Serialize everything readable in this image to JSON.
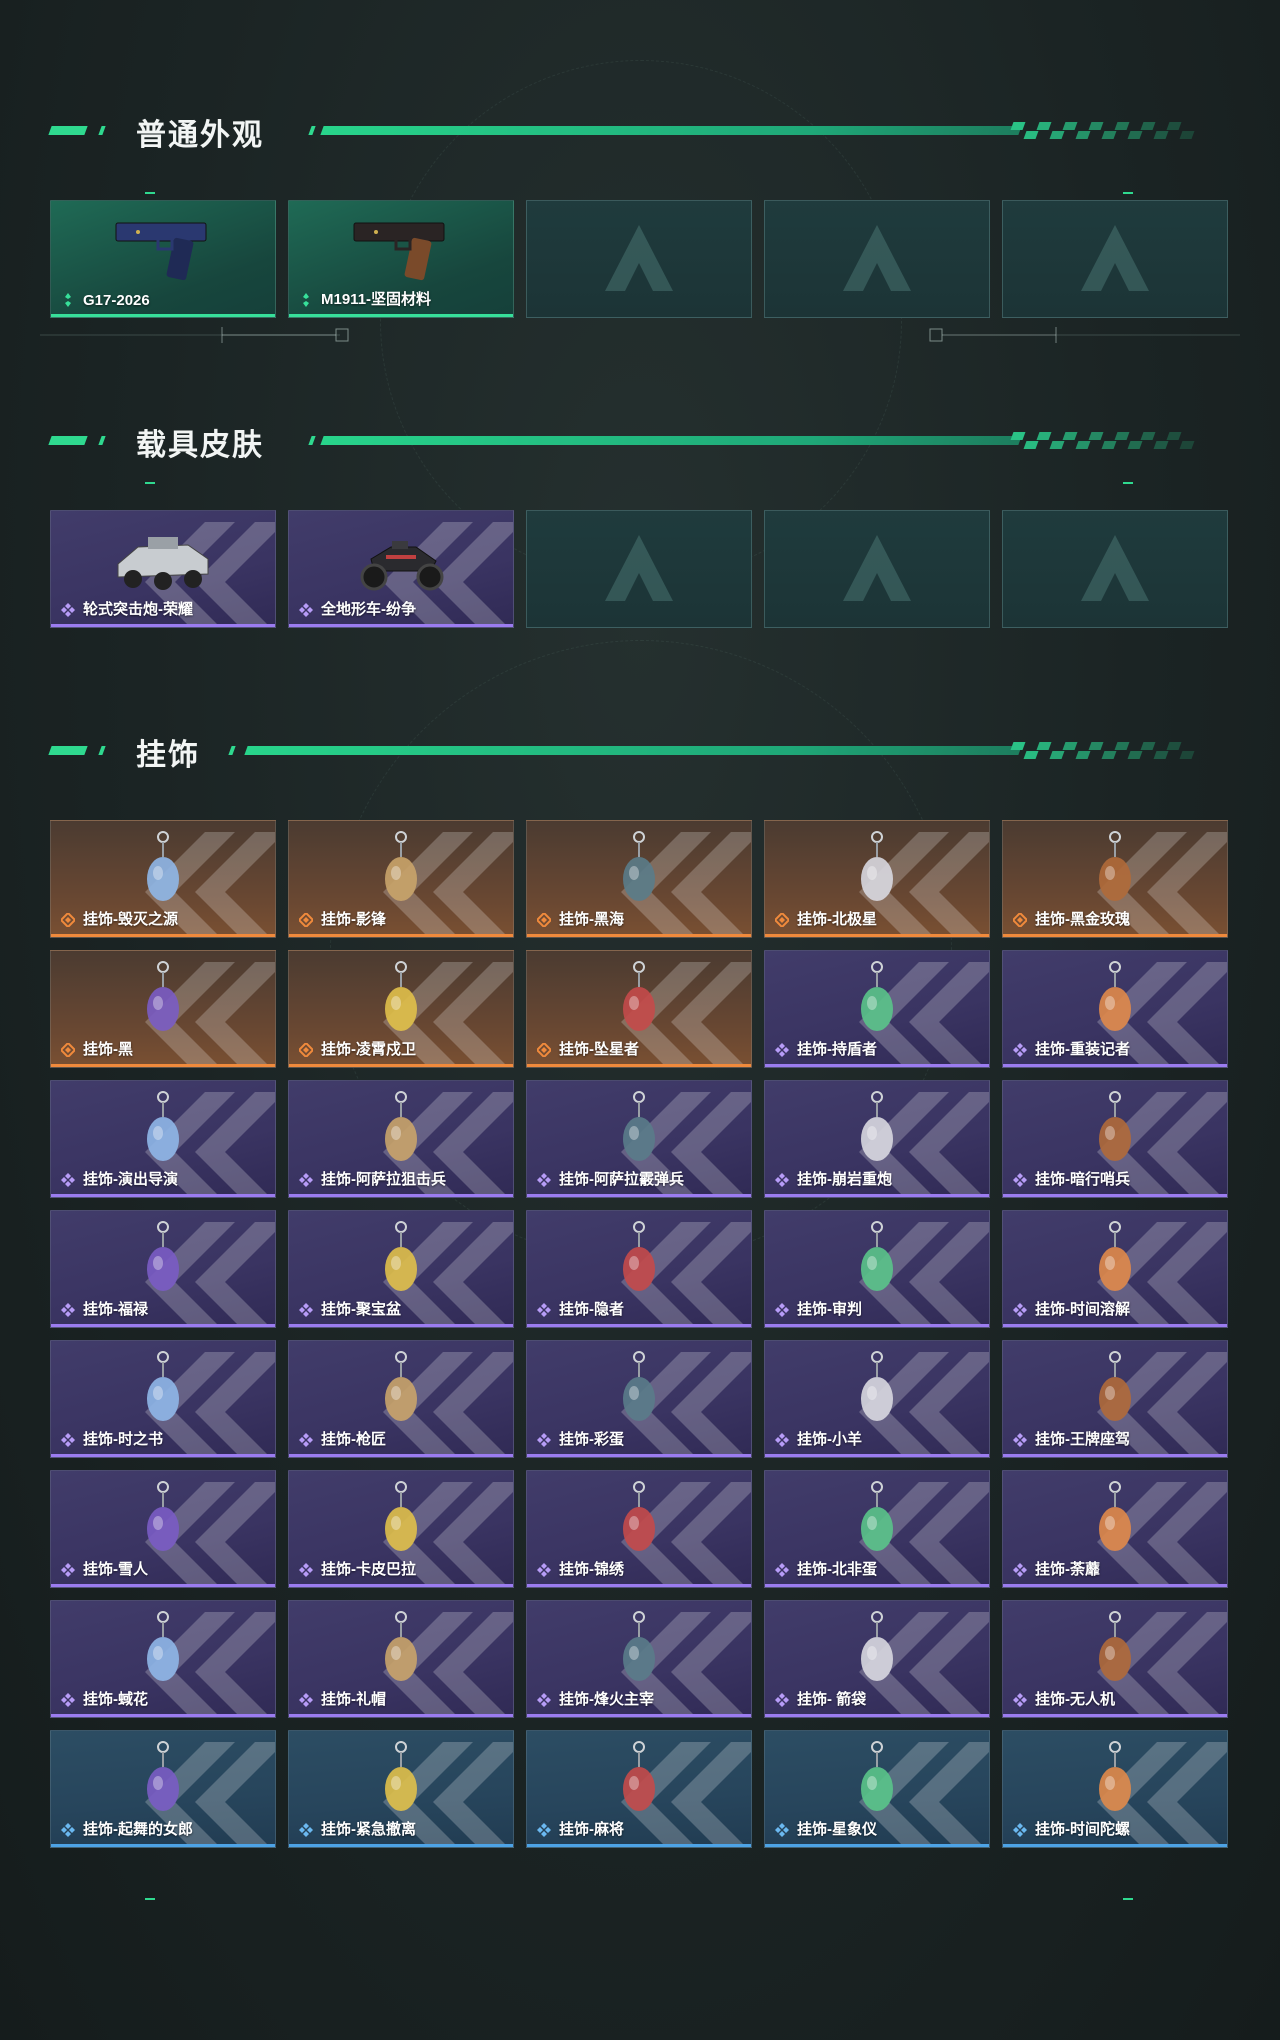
{
  "sections": {
    "weapon_skins": {
      "title": "普通外观",
      "items": [
        {
          "label": "G17-2026",
          "tier": "green",
          "icon": "pistol-icon"
        },
        {
          "label": "M1911-坚固材料",
          "tier": "green",
          "icon": "pistol-icon"
        },
        {
          "label": "",
          "tier": "empty"
        },
        {
          "label": "",
          "tier": "empty"
        },
        {
          "label": "",
          "tier": "empty"
        }
      ]
    },
    "vehicle_skins": {
      "title": "载具皮肤",
      "items": [
        {
          "label": "轮式突击炮-荣耀",
          "tier": "purple",
          "icon": "vehicle-icon"
        },
        {
          "label": "全地形车-纷争",
          "tier": "purple",
          "icon": "atv-icon"
        },
        {
          "label": "",
          "tier": "empty"
        },
        {
          "label": "",
          "tier": "empty"
        },
        {
          "label": "",
          "tier": "empty"
        }
      ]
    },
    "charms": {
      "title": "挂饰",
      "items": [
        {
          "label": "挂饰-毁灭之源",
          "tier": "orange"
        },
        {
          "label": "挂饰-影锋",
          "tier": "orange"
        },
        {
          "label": "挂饰-黑海",
          "tier": "orange"
        },
        {
          "label": "挂饰-北极星",
          "tier": "orange"
        },
        {
          "label": "挂饰-黑金玫瑰",
          "tier": "orange"
        },
        {
          "label": "挂饰-黑",
          "tier": "orange"
        },
        {
          "label": "挂饰-凌霄戍卫",
          "tier": "orange"
        },
        {
          "label": "挂饰-坠星者",
          "tier": "orange"
        },
        {
          "label": "挂饰-持盾者",
          "tier": "purple"
        },
        {
          "label": "挂饰-重装记者",
          "tier": "purple"
        },
        {
          "label": "挂饰-演出导演",
          "tier": "purple"
        },
        {
          "label": "挂饰-阿萨拉狙击兵",
          "tier": "purple"
        },
        {
          "label": "挂饰-阿萨拉霰弹兵",
          "tier": "purple"
        },
        {
          "label": "挂饰-崩岩重炮",
          "tier": "purple"
        },
        {
          "label": "挂饰-暗行哨兵",
          "tier": "purple"
        },
        {
          "label": "挂饰-福禄",
          "tier": "purple"
        },
        {
          "label": "挂饰-聚宝盆",
          "tier": "purple"
        },
        {
          "label": "挂饰-隐者",
          "tier": "purple"
        },
        {
          "label": "挂饰-审判",
          "tier": "purple"
        },
        {
          "label": "挂饰-时间溶解",
          "tier": "purple"
        },
        {
          "label": "挂饰-时之书",
          "tier": "purple"
        },
        {
          "label": "挂饰-枪匠",
          "tier": "purple"
        },
        {
          "label": "挂饰-彩蛋",
          "tier": "purple"
        },
        {
          "label": "挂饰-小羊",
          "tier": "purple"
        },
        {
          "label": "挂饰-王牌座驾",
          "tier": "purple"
        },
        {
          "label": "挂饰-雪人",
          "tier": "purple"
        },
        {
          "label": "挂饰-卡皮巴拉",
          "tier": "purple"
        },
        {
          "label": "挂饰-锦绣",
          "tier": "purple"
        },
        {
          "label": "挂饰-北非蛋",
          "tier": "purple"
        },
        {
          "label": "挂饰-荼蘼",
          "tier": "purple"
        },
        {
          "label": "挂饰-蜮花",
          "tier": "purple"
        },
        {
          "label": "挂饰-礼帽",
          "tier": "purple"
        },
        {
          "label": "挂饰-烽火主宰",
          "tier": "purple"
        },
        {
          "label": "挂饰- 箭袋",
          "tier": "purple"
        },
        {
          "label": "挂饰-无人机",
          "tier": "purple"
        },
        {
          "label": "挂饰-起舞的女郎",
          "tier": "blue"
        },
        {
          "label": "挂饰-紧急撤离",
          "tier": "blue"
        },
        {
          "label": "挂饰-麻将",
          "tier": "blue"
        },
        {
          "label": "挂饰-星象仪",
          "tier": "blue"
        },
        {
          "label": "挂饰-时间陀螺",
          "tier": "blue"
        }
      ]
    }
  },
  "colors": {
    "accent": "#2fd98f",
    "green_tier": "#37e09a",
    "purple_tier": "#9b7cf0",
    "orange_tier": "#f08a3c",
    "blue_tier": "#4da3e6"
  }
}
